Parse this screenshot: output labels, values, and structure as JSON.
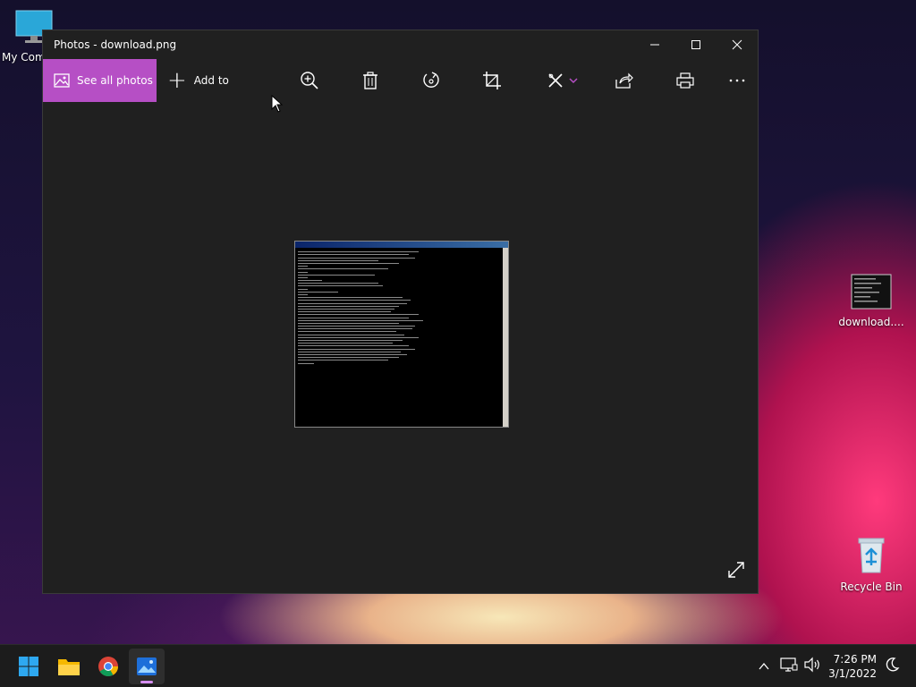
{
  "desktop": {
    "icons": {
      "my_computer": "My Computer",
      "download": "download....",
      "recycle_bin": "Recycle Bin"
    }
  },
  "window": {
    "title": "Photos - download.png",
    "toolbar": {
      "see_all_photos": "See all photos",
      "add_to": "Add to"
    }
  },
  "taskbar": {
    "apps": [
      "start-icon",
      "file-explorer-icon",
      "chrome-icon",
      "photos-icon"
    ],
    "time": "7:26 PM",
    "date": "3/1/2022"
  },
  "colors": {
    "accent": "#b64fc5",
    "window_bg": "#202020",
    "taskbar_bg": "#1c1c1c"
  }
}
